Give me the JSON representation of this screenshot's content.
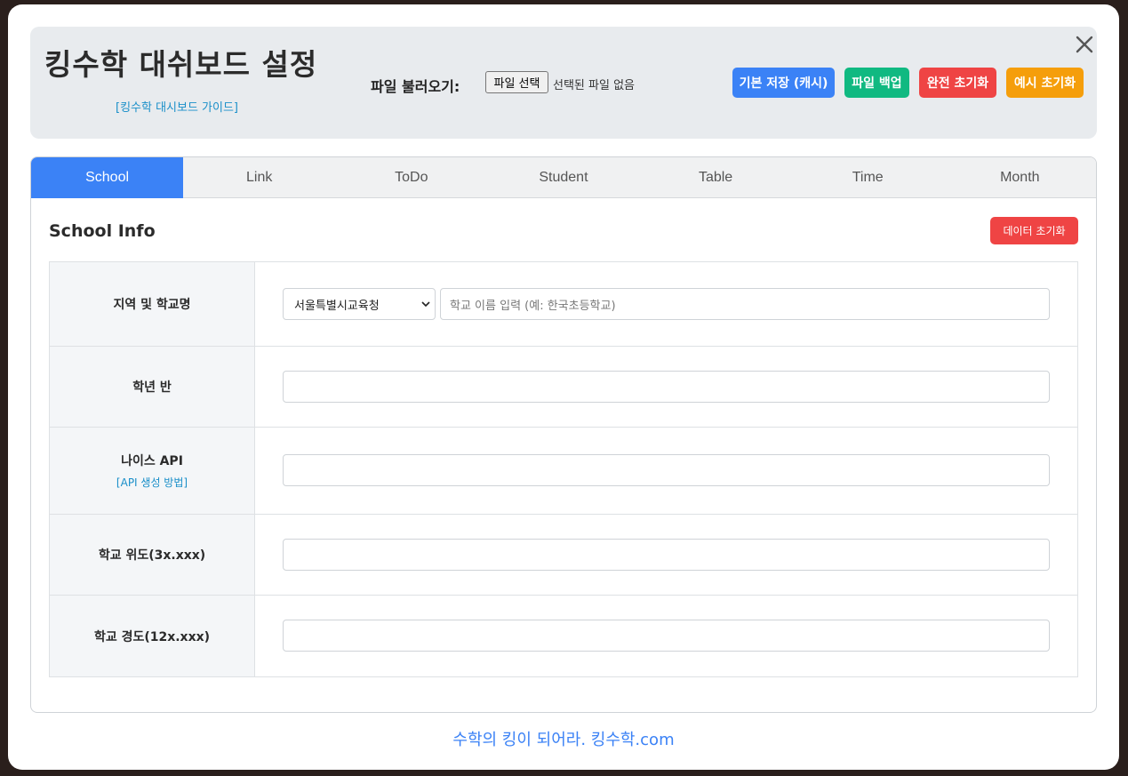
{
  "header": {
    "title": "킹수학 대쉬보드 설정",
    "guide_link": "[킹수학 대시보드 가이드]",
    "file_label": "파일 불러오기:",
    "file_button": "파일 선택",
    "file_status": "선택된 파일 없음",
    "buttons": {
      "cache_save": "기본 저장 (캐시)",
      "file_backup": "파일 백업",
      "full_reset": "완전 초기화",
      "example_reset": "예시 초기화"
    },
    "close_icon": "close-icon"
  },
  "tabs": [
    {
      "label": "School",
      "active": true
    },
    {
      "label": "Link",
      "active": false
    },
    {
      "label": "ToDo",
      "active": false
    },
    {
      "label": "Student",
      "active": false
    },
    {
      "label": "Table",
      "active": false
    },
    {
      "label": "Time",
      "active": false
    },
    {
      "label": "Month",
      "active": false
    }
  ],
  "section": {
    "title": "School Info",
    "reset_button": "데이터 초기화"
  },
  "form": {
    "region_school": {
      "label": "지역 및 학교명",
      "select_value": "서울특별시교육청",
      "school_placeholder": "학교 이름 입력 (예: 한국초등학교)"
    },
    "grade_class": {
      "label": "학년 반",
      "value": ""
    },
    "neis_api": {
      "label": "나이스 API",
      "sub_link": "[API 생성 방법]",
      "value": ""
    },
    "latitude": {
      "label": "학교 위도(3x.xxx)",
      "value": ""
    },
    "longitude": {
      "label": "학교 경도(12x.xxx)",
      "value": ""
    }
  },
  "footer": {
    "text": "수학의 킹이 되어라. 킹수학.com"
  },
  "colors": {
    "primary": "#3b82f6",
    "success": "#10b981",
    "danger": "#ef4444",
    "warning": "#f59e0b",
    "link": "#1a8fc9"
  }
}
